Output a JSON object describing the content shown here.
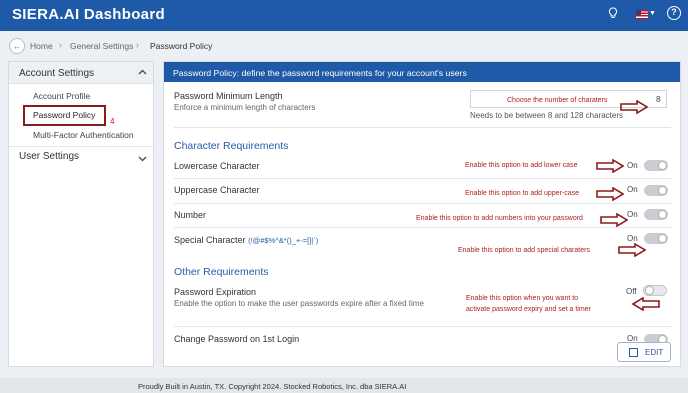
{
  "app": {
    "brand": "SIERA.AI Dashboard"
  },
  "breadcrumb": {
    "items": [
      "Home",
      "General Settings",
      "Password Policy"
    ]
  },
  "sidebar": {
    "account_settings": "Account Settings",
    "items": [
      "Account Profile",
      "Password Policy",
      "Multi-Factor Authentication"
    ],
    "step_number": "4",
    "user_settings": "User Settings"
  },
  "panel": {
    "header": "Password Policy: define the password requirements for your account's users",
    "min_length": {
      "title": "Password Minimum Length",
      "subtitle": "Enforce a minimum length of characters",
      "value": "8",
      "hint": "Needs to be between 8 and 128 characters",
      "note": "Choose the number of charaters"
    },
    "character_requirements": {
      "title": "Character Requirements",
      "rows": [
        {
          "label": "Lowercase Character",
          "state": "On",
          "note": "Enable this option to add lower case"
        },
        {
          "label": "Uppercase Character",
          "state": "On",
          "note": "Enable this option to add upper-case"
        },
        {
          "label": "Number",
          "state": "On",
          "note": "Enable this option to add numbers into your password"
        },
        {
          "label": "Special Character",
          "chars": "(!@#$%^&*()_+-=[]|`)",
          "state": "On",
          "note": "Enable this option to add special charaters"
        }
      ]
    },
    "other_requirements": {
      "title": "Other Requirements",
      "expiration": {
        "title": "Password Expiration",
        "subtitle": "Enable the option to make the user passwords expire after a fixed time",
        "state": "Off",
        "note_line1": "Enable this option when you want to",
        "note_line2": "activate password expiry and set a timer"
      },
      "change_first_login": {
        "title": "Change Password on 1st Login",
        "state": "On"
      }
    },
    "edit_label": "EDIT"
  },
  "footer": "Proudly Built in Austin, TX. Copyright 2024. Stocked Robotics, Inc. dba SIERA.AI",
  "colors": {
    "brand_blue": "#1e5aa8",
    "annotation_red": "#8b1a1a"
  }
}
